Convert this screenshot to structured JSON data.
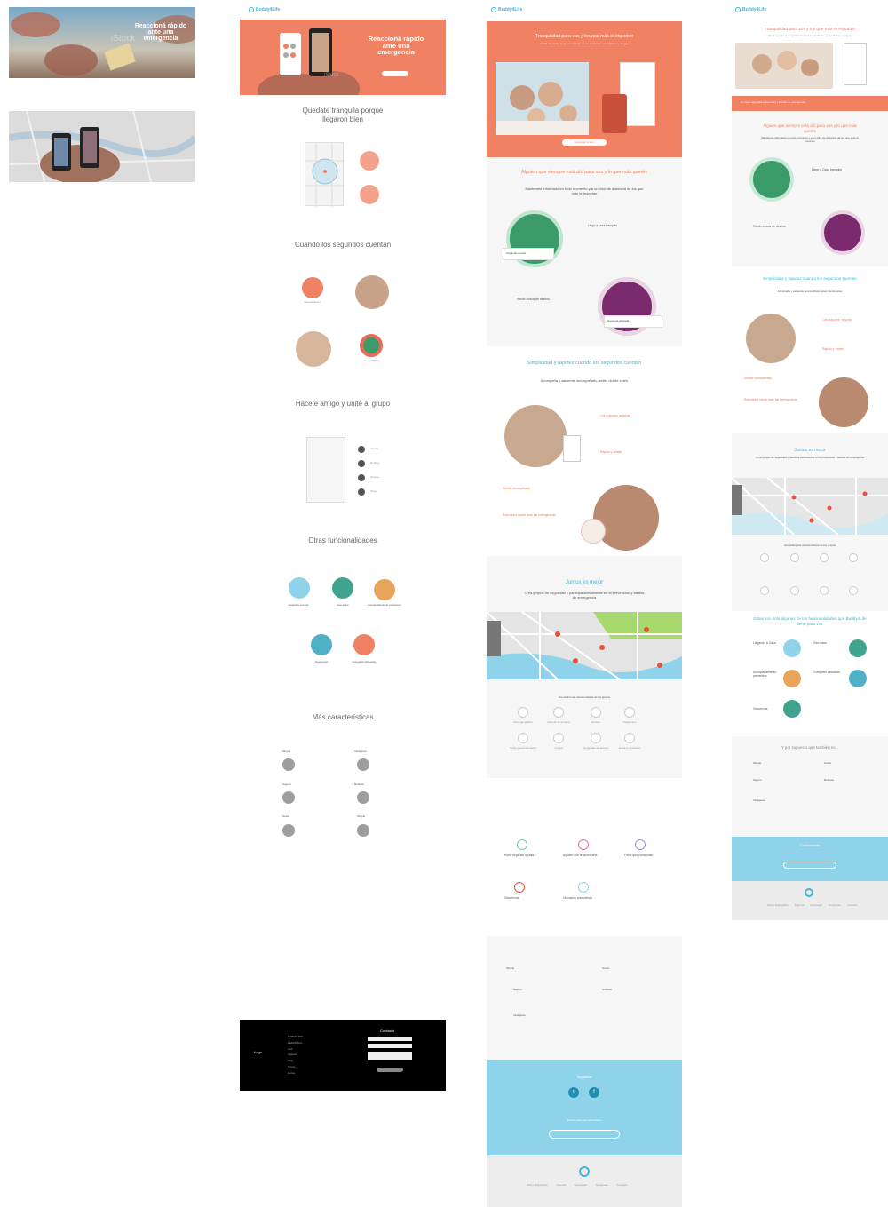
{
  "col1": {
    "hero_title": "Reaccioná rápido ante una emergencia",
    "watermark": "iStock"
  },
  "col2": {
    "logo": "Buddy4Life",
    "hero_title": "Reaccioná rápido ante una emergencia",
    "hero_watermark": "iStock",
    "s1_title": "Quedate tranquila porque llegaron bien",
    "s2_title": "Cuando los segundos cuentan",
    "s2_items": [
      "Rapida accion",
      "Acompañante"
    ],
    "s3_title": "Hacete amigo y unite al grupo",
    "s3_names": [
      "Camila",
      "Rodrigo",
      "Nicolas",
      "Pepe"
    ],
    "s4_title": "Otras funcionalidades",
    "s4_items": [
      "Llegando a Casa",
      "Geo-fotos",
      "Acompañamiento preventivo",
      "Geocercas",
      "Compartir ubicación"
    ],
    "s5_title": "Más características",
    "s5_items": [
      "Simple",
      "Inteligente",
      "Seguro",
      "Robusto",
      "Gratis",
      "Simple"
    ],
    "footer_logo": "Logo",
    "footer_contact": "Contacto",
    "footer_links": [
      "Product Tour",
      "LEADS Tour",
      "Link",
      "Support",
      "Blog",
      "Terms",
      "Home"
    ]
  },
  "col3": {
    "logo": "Buddy4Life",
    "hero_title": "Tranquilidad para vos y los que más te importan",
    "hero_sub": "Cuidá tus seres, seguí el progreso de tus contactos, compañeros y amigos",
    "hero_btn": "Descargá la app",
    "s1_title": "Alguien que siempre está ahí para vos y lo que más querés",
    "s1_sub": "Mantenete informado en todo momento y a un click de distancia de los que más te importan",
    "s1_items": [
      "Llegó a casa tranquilo",
      "Recibí avisos de destino"
    ],
    "s1_card1": "Llegando a casa",
    "s1_card2": "Geozona activada",
    "s2_title": "Simplicidad y rapidez cuando los segundos cuentan",
    "s2_sub": "Acompaña y asistente acompañado, estés donde estés",
    "s2_items": [
      "Los mayores, seguros",
      "Rápido y simple",
      "Sentite acompañado",
      "Reacciona rápido ante las emergencias"
    ],
    "s3_title": "Juntos es mejor",
    "s3_sub": "Creá grupos de seguridad y participa activamente en la prevención y alertas de emergencia",
    "s3_caption": "Vos definís las características de los grupos",
    "s3_rings": [
      "Zona geográfica",
      "Hora de la semana",
      "Horario",
      "Integrantes",
      "Todos geoconfirmados",
      "Grupal",
      "Geografía del acceso",
      "Envía tu ubicación"
    ],
    "s4_items": [
      "Estoy llegando a casa...",
      "Alguien que te acompañe",
      "Fotos que comunican",
      "Geocercas",
      "Ubicación compartida"
    ],
    "s5_items": [
      "Simple",
      "Gratis",
      "Seguro",
      "Robusto",
      "Inteligente"
    ],
    "social_title": "Seguinos",
    "social_text": "Escribí para más información",
    "footer_links": [
      "Sobre Buddy4Life",
      "Soporte",
      "Descargar",
      "Empresas",
      "Contacto"
    ]
  },
  "col4": {
    "logo": "Buddy4Life",
    "hero_title": "Tranquilidad para vos y los que más te importan",
    "hero_sub": "Tomá tus pasos, seguimiento con tus familiares, compañeros y amigos",
    "hero_btn": "Descargá la app",
    "hero_strip": "Lo mejor app para prevención y alertas de emergencia",
    "s1_title": "Alguien que siempre está ahí para vos y lo que más querés",
    "s1_sub": "Mantenete informado en todo momento y a un click de distancia de los que más te importan",
    "s1_items": [
      "Llegó a Casa tranquilo",
      "Recibí avisos de destino"
    ],
    "s2_title": "Simplicidad y rapidez cuando los segundos cuentan",
    "s2_sub": "Acompaña y asistente acompañado estés donde estés",
    "s2_items": [
      "Los mayores, seguros",
      "Rápido y simple",
      "Sentite acompañado",
      "Reaccioná rápido ante las emergencias"
    ],
    "s3_title": "Juntos es mejor",
    "s3_sub": "Creá grupos de seguridad y participa activamente en la prevención y alertas de emergencia",
    "s3_caption": "Vos definís las características de los grupos",
    "s4_title": "Estas son sólo algunas de las funcionalidades que Buddy4Life tiene para vos",
    "s4_items": [
      "Llegando a Casa",
      "Geo-fotos",
      "Acompañamiento preventivo",
      "Compartir ubicación",
      "Geocercas"
    ],
    "s5_title": "Y por supuesto que también es...",
    "s5_items": [
      "Simple",
      "Gratis",
      "Seguro",
      "Robusto",
      "Inteligente"
    ],
    "contact_title": "Contactanos",
    "footer_links": [
      "Sobre Buddy4Life",
      "Soporte",
      "Descargar",
      "Empresas",
      "Contacto"
    ]
  },
  "colors": {
    "coral": "#f08163",
    "teal": "#3fb6d5",
    "sky": "#8fd3ea",
    "purple": "#7b2a6e",
    "green": "#3a9a6a"
  }
}
